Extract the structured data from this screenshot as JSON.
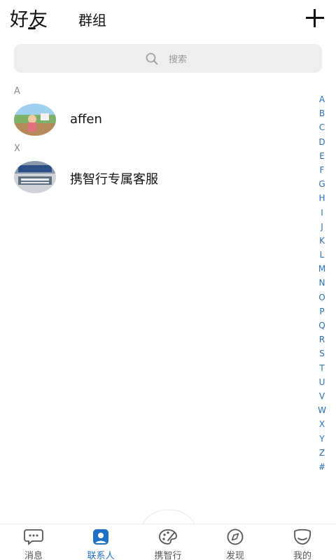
{
  "header": {
    "tab_friends": "好友",
    "tab_groups": "群组"
  },
  "search": {
    "placeholder": "搜索"
  },
  "sections": [
    {
      "letter": "A",
      "contacts": [
        {
          "name": "affen"
        }
      ]
    },
    {
      "letter": "X",
      "contacts": [
        {
          "name": "携智行专属客服"
        }
      ]
    }
  ],
  "alpha_index": [
    "A",
    "B",
    "C",
    "D",
    "E",
    "F",
    "G",
    "H",
    "I",
    "J",
    "K",
    "L",
    "M",
    "N",
    "O",
    "P",
    "Q",
    "R",
    "S",
    "T",
    "U",
    "V",
    "W",
    "X",
    "Y",
    "Z",
    "#"
  ],
  "bottom_nav": [
    {
      "label": "消息",
      "icon": "chat-bubble-icon",
      "active": false
    },
    {
      "label": "联系人",
      "icon": "contacts-icon",
      "active": true
    },
    {
      "label": "携智行",
      "icon": "palette-icon",
      "active": false
    },
    {
      "label": "发现",
      "icon": "compass-icon",
      "active": false
    },
    {
      "label": "我的",
      "icon": "profile-icon",
      "active": false
    }
  ],
  "colors": {
    "accent": "#1f6fc5",
    "index_letter": "#2a6fb3",
    "search_bg": "#eeeeee"
  }
}
